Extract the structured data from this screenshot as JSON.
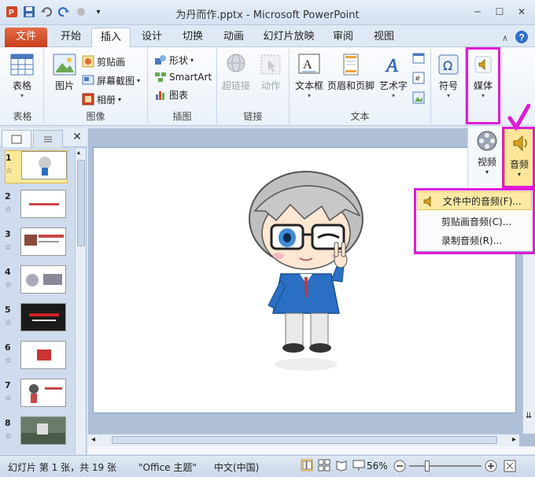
{
  "window": {
    "title": "为丹而作.pptx - Microsoft PowerPoint"
  },
  "tabs": {
    "file": "文件",
    "items": [
      "开始",
      "插入",
      "设计",
      "切换",
      "动画",
      "幻灯片放映",
      "审阅",
      "视图"
    ],
    "active": "插入"
  },
  "ribbon": {
    "table_group": {
      "button": "表格",
      "label": "表格"
    },
    "image_group": {
      "picture": "图片",
      "clipart": "剪贴画",
      "screenshot": "屏幕截图",
      "album": "相册",
      "label": "图像"
    },
    "illustration_group": {
      "shapes": "形状",
      "smartart": "SmartArt",
      "chart": "图表",
      "label": "插图"
    },
    "link_group": {
      "hyperlink": "超链接",
      "action": "动作",
      "label": "链接"
    },
    "text_group": {
      "textbox": "文本框",
      "header_footer": "页眉和页脚",
      "wordart": "艺术字",
      "label": "文本"
    },
    "symbol_group": {
      "symbol": "符号"
    },
    "media_group": {
      "media": "媒体"
    }
  },
  "media_panel": {
    "video": "视频",
    "audio": "音频"
  },
  "audio_menu": {
    "items": [
      "文件中的音频(F)...",
      "剪贴画音频(C)...",
      "录制音频(R)..."
    ]
  },
  "slides": [
    {
      "num": "1"
    },
    {
      "num": "2"
    },
    {
      "num": "3"
    },
    {
      "num": "4"
    },
    {
      "num": "5"
    },
    {
      "num": "6"
    },
    {
      "num": "7"
    },
    {
      "num": "8"
    }
  ],
  "status": {
    "slide_info": "幻灯片 第 1 张，共 19 张",
    "theme": "\"Office 主题\"",
    "language": "中文(中国)",
    "zoom": "56%"
  }
}
